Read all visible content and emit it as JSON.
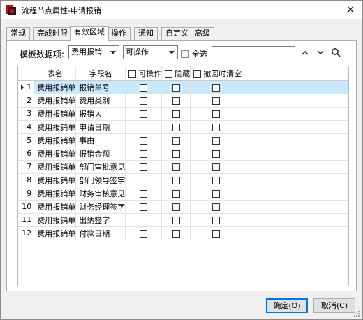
{
  "window": {
    "title": "流程节点属性-申请报销",
    "close_glyph": "✕"
  },
  "tabs": [
    {
      "label": "常规"
    },
    {
      "label": "完成时限"
    },
    {
      "label": "有效区域"
    },
    {
      "label": "操作"
    },
    {
      "label": "通知"
    },
    {
      "label": "自定义"
    },
    {
      "label": "高级"
    }
  ],
  "active_tab": "有效区域",
  "filter": {
    "label": "模板数据项:",
    "item_combo": "费用报销",
    "action_combo": "可操作",
    "select_all_label": "全选",
    "search_value": ""
  },
  "grid": {
    "columns": [
      "表名",
      "字段名",
      "可操作",
      "隐藏",
      "撤回时清空"
    ],
    "rows": [
      {
        "num": "1",
        "table": "费用报销单",
        "field": "报销单号",
        "op": false,
        "hide": false,
        "clear": false
      },
      {
        "num": "2",
        "table": "费用报销单",
        "field": "费用类别",
        "op": false,
        "hide": false,
        "clear": false
      },
      {
        "num": "3",
        "table": "费用报销单",
        "field": "报销人",
        "op": false,
        "hide": false,
        "clear": false
      },
      {
        "num": "4",
        "table": "费用报销单",
        "field": "申请日期",
        "op": false,
        "hide": false,
        "clear": false
      },
      {
        "num": "5",
        "table": "费用报销单",
        "field": "事由",
        "op": false,
        "hide": false,
        "clear": false
      },
      {
        "num": "6",
        "table": "费用报销单",
        "field": "报销金额",
        "op": false,
        "hide": false,
        "clear": false
      },
      {
        "num": "7",
        "table": "费用报销单",
        "field": "部门审批意见",
        "op": false,
        "hide": false,
        "clear": false
      },
      {
        "num": "8",
        "table": "费用报销单",
        "field": "部门领导签字",
        "op": false,
        "hide": false,
        "clear": false
      },
      {
        "num": "9",
        "table": "费用报销单",
        "field": "财务审核意见",
        "op": false,
        "hide": false,
        "clear": false
      },
      {
        "num": "10",
        "table": "费用报销单",
        "field": "财务经理签字",
        "op": false,
        "hide": false,
        "clear": false
      },
      {
        "num": "11",
        "table": "费用报销单",
        "field": "出纳签字",
        "op": false,
        "hide": false,
        "clear": false
      },
      {
        "num": "12",
        "table": "费用报销单",
        "field": "付款日期",
        "op": false,
        "hide": false,
        "clear": false
      }
    ],
    "selected_row": "1"
  },
  "buttons": {
    "ok": "确定(O)",
    "cancel": "取消(C)"
  },
  "colors": {
    "selection": "#cce8ff",
    "default_button_border": "#0078d7",
    "icon_red": "#d0021b"
  }
}
